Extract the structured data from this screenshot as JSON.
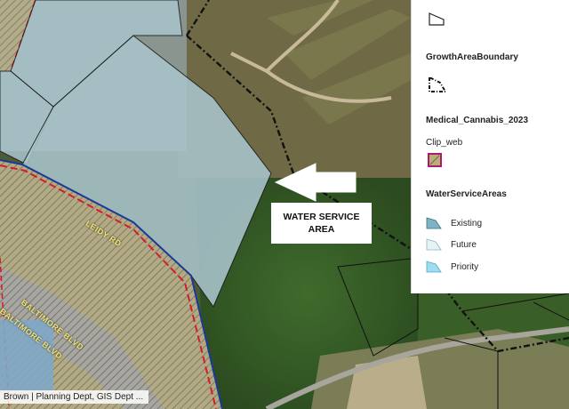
{
  "map": {
    "annotation": {
      "text": "WATER SERVICE\nAREA"
    },
    "road_labels": [
      "LEIDY RD",
      "BALTIMORE BLVD",
      "BALTIMORE BLVD"
    ],
    "attribution": "Brown | Planning Dept, GIS Dept ...",
    "colors": {
      "service_area_fill": "#a9c4cc",
      "cannabis_outline": "#c2185b",
      "boundary_line": "#111111",
      "hatch_fill": "#b9b08a"
    }
  },
  "legend": {
    "layers": [
      {
        "title": "",
        "symbol": "flag-outline-icon"
      },
      {
        "title": "GrowthAreaBoundary",
        "symbol": "dashed-polygon-icon"
      },
      {
        "title": "Medical_Cannabis_2023",
        "sublabel": "Clip_web",
        "symbol": "cannabis-clip-swatch"
      },
      {
        "title": "WaterServiceAreas",
        "classes": [
          {
            "label": "Existing",
            "color": "#7fb2c2"
          },
          {
            "label": "Future",
            "color": "#e6f3f6"
          },
          {
            "label": "Priority",
            "color": "#9fdcf0"
          }
        ]
      }
    ]
  }
}
